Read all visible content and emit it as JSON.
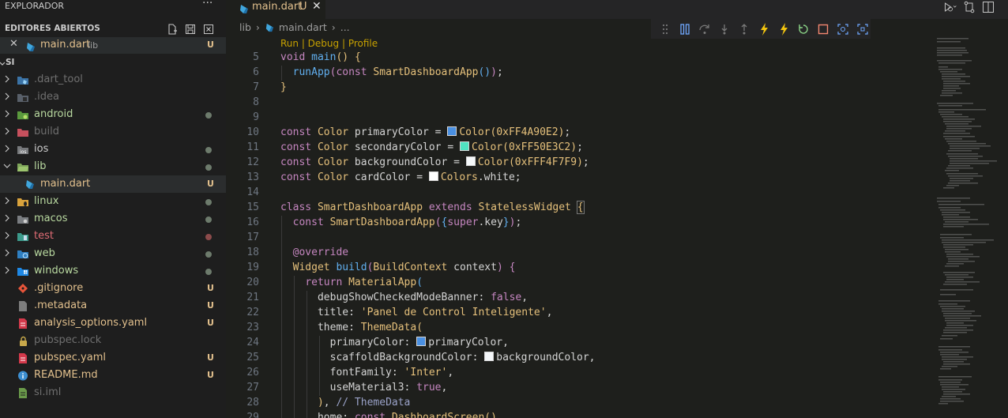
{
  "sidebar": {
    "title": "EXPLORADOR",
    "open_editors_label": "EDITORES ABIERTOS",
    "open_editor": {
      "name": "main.dart",
      "desc": "lib",
      "status": "U"
    },
    "workspace_label": "SI",
    "items": [
      {
        "name": "dart_tool_label",
        "label": ".dart_tool",
        "status": ""
      },
      {
        "label": ".idea",
        "status": ""
      },
      {
        "label": "android",
        "status": "dot"
      },
      {
        "label": "build",
        "status": ""
      },
      {
        "label": "ios",
        "status": "dot"
      },
      {
        "label": "lib",
        "status": "dot"
      },
      {
        "label": "main.dart",
        "status": "U"
      },
      {
        "label": "linux",
        "status": "dot"
      },
      {
        "label": "macos",
        "status": "dot"
      },
      {
        "label": "test",
        "status": "dot-red"
      },
      {
        "label": "web",
        "status": "dot"
      },
      {
        "label": "windows",
        "status": "dot"
      },
      {
        "label": ".gitignore",
        "status": "U"
      },
      {
        "label": ".metadata",
        "status": "U"
      },
      {
        "label": "analysis_options.yaml",
        "status": "U"
      },
      {
        "label": "pubspec.lock",
        "status": ""
      },
      {
        "label": "pubspec.yaml",
        "status": "U"
      },
      {
        "label": "README.md",
        "status": "U"
      },
      {
        "label": "si.iml",
        "status": ""
      }
    ]
  },
  "tab": {
    "name": "main.dart",
    "status": "U"
  },
  "breadcrumb": {
    "folder": "lib",
    "file": "main.dart",
    "more": "..."
  },
  "codelens": "Run | Debug | Profile",
  "line_numbers": [
    "5",
    "6",
    "7",
    "8",
    "9",
    "10",
    "11",
    "12",
    "13",
    "14",
    "15",
    "16",
    "17",
    "18",
    "19",
    "20",
    "21",
    "22",
    "23",
    "24",
    "25",
    "26",
    "27",
    "28",
    "29"
  ],
  "colors": {
    "accent": "#e2c08d",
    "primary_swatch": "#4A90E2",
    "secondary_swatch": "#50E3C2",
    "background_swatch": "#F4F7F9",
    "card_swatch": "#FFFFFF"
  }
}
